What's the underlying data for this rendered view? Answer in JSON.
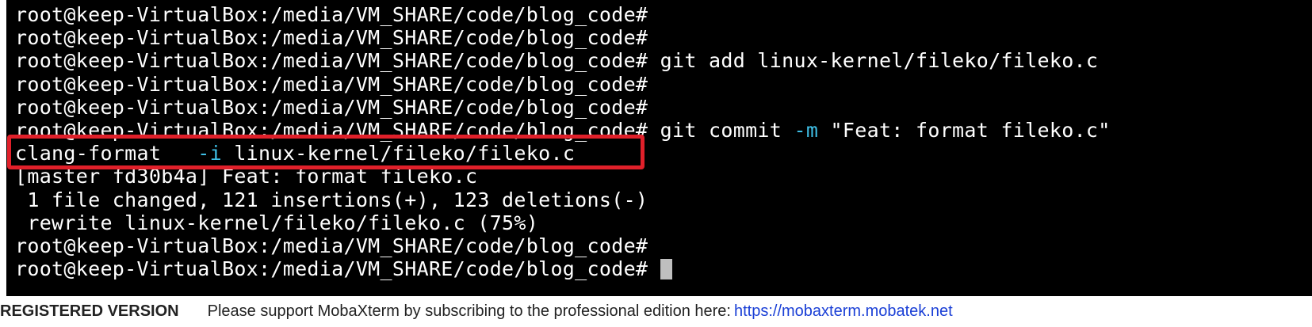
{
  "terminal": {
    "prompt": "root@keep-VirtualBox:/media/VM_SHARE/code/blog_code#",
    "colors": {
      "background": "#000000",
      "text": "#ffffff",
      "flag": "#3fbfe6",
      "highlight": "#e0202a"
    },
    "lines": [
      {
        "text": "root@keep-VirtualBox:/media/VM_SHARE/code/blog_code#"
      },
      {
        "text": "root@keep-VirtualBox:/media/VM_SHARE/code/blog_code#"
      },
      {
        "text": "root@keep-VirtualBox:/media/VM_SHARE/code/blog_code# git add linux-kernel/fileko/fileko.c"
      },
      {
        "text": "root@keep-VirtualBox:/media/VM_SHARE/code/blog_code#"
      },
      {
        "text": "root@keep-VirtualBox:/media/VM_SHARE/code/blog_code#"
      },
      {
        "pre": "root@keep-VirtualBox:/media/VM_SHARE/code/blog_code# git commit ",
        "flag": "-m",
        "post": " \"Feat: format fileko.c\""
      },
      {
        "pre": "clang-format   ",
        "flag": "-i",
        "post": " linux-kernel/fileko/fileko.c"
      },
      {
        "text": "[master fd30b4a] Feat: format fileko.c"
      },
      {
        "text": " 1 file changed, 121 insertions(+), 123 deletions(-)"
      },
      {
        "text": " rewrite linux-kernel/fileko/fileko.c (75%)"
      },
      {
        "text": "root@keep-VirtualBox:/media/VM_SHARE/code/blog_code#"
      },
      {
        "text": "root@keep-VirtualBox:/media/VM_SHARE/code/blog_code# "
      }
    ]
  },
  "watermark": {
    "brand": "REGISTERED VERSION",
    "message": "Please support MobaXterm by subscribing to the professional edition here:",
    "link": "https://mobaxterm.mobatek.net"
  }
}
